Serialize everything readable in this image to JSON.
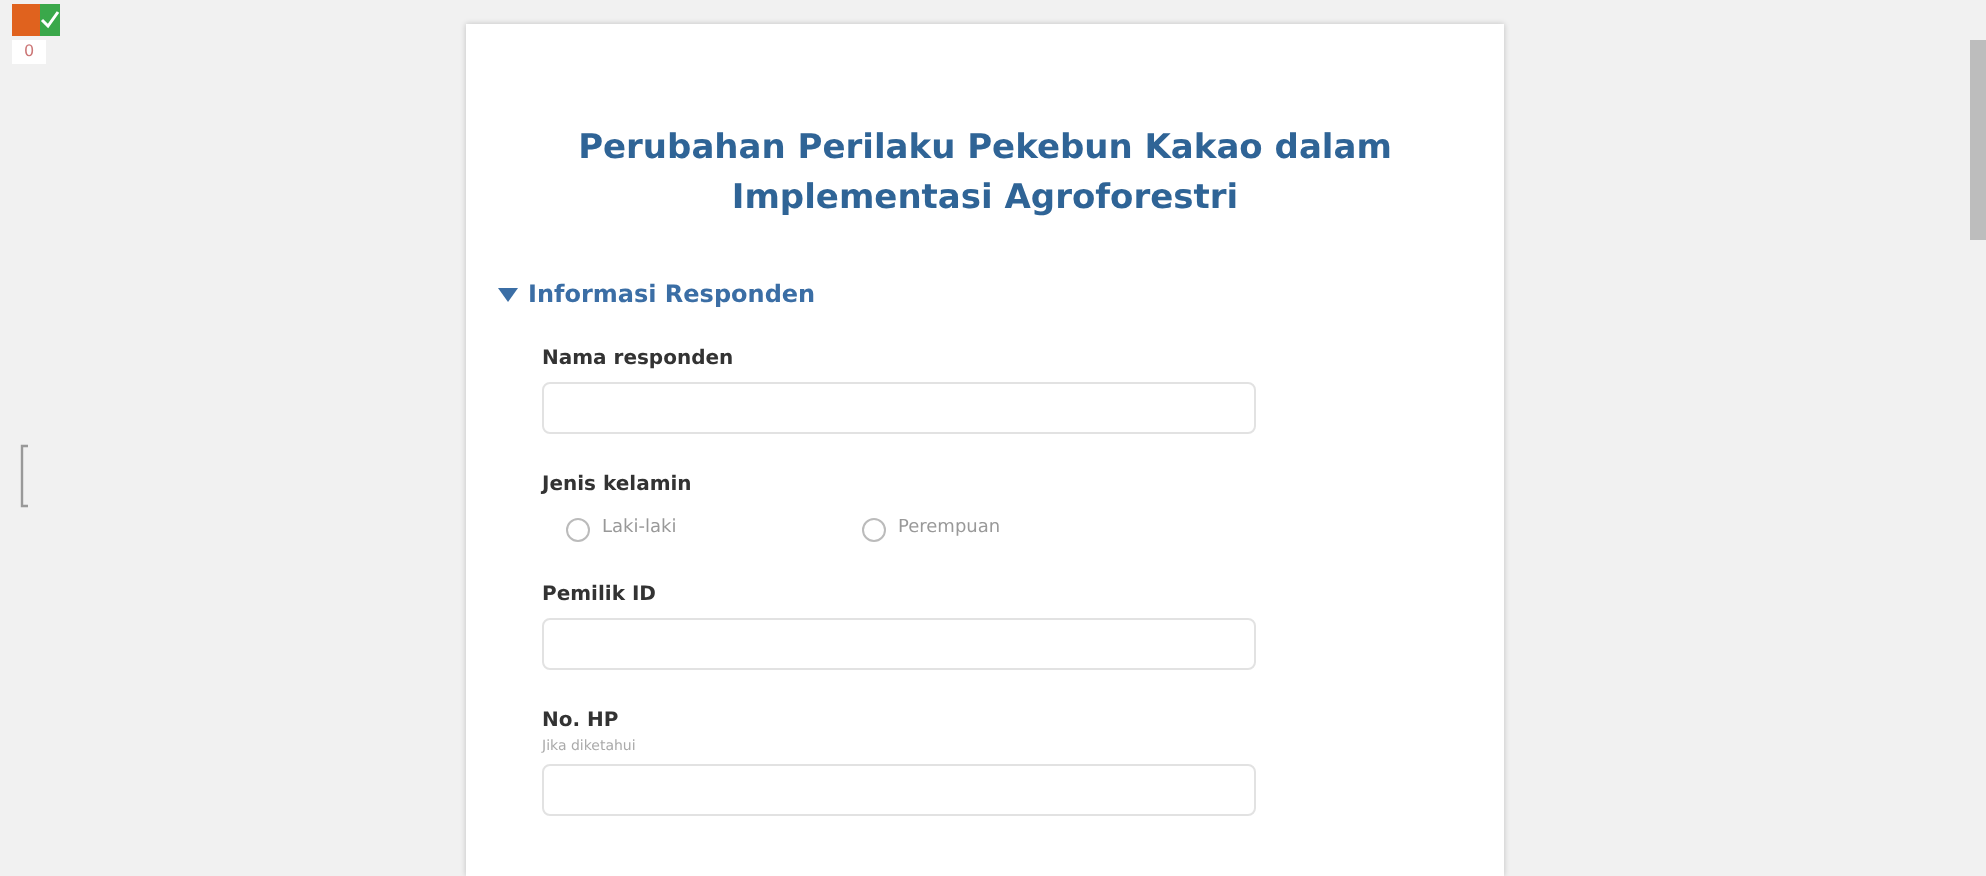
{
  "app_badge": {
    "count": "0"
  },
  "form": {
    "title": "Perubahan Perilaku Pekebun Kakao dalam Implementasi Agroforestri",
    "section": {
      "title": "Informasi Responden",
      "expanded": true,
      "questions": [
        {
          "kind": "text",
          "label": "Nama responden"
        },
        {
          "kind": "radio",
          "label": "Jenis kelamin",
          "options": [
            {
              "label": "Laki-laki",
              "selected": false
            },
            {
              "label": "Perempuan",
              "selected": false
            }
          ]
        },
        {
          "kind": "text",
          "label": "Pemilik ID"
        },
        {
          "kind": "text",
          "label": "No. HP",
          "hint": "Jika diketahui"
        }
      ]
    }
  }
}
